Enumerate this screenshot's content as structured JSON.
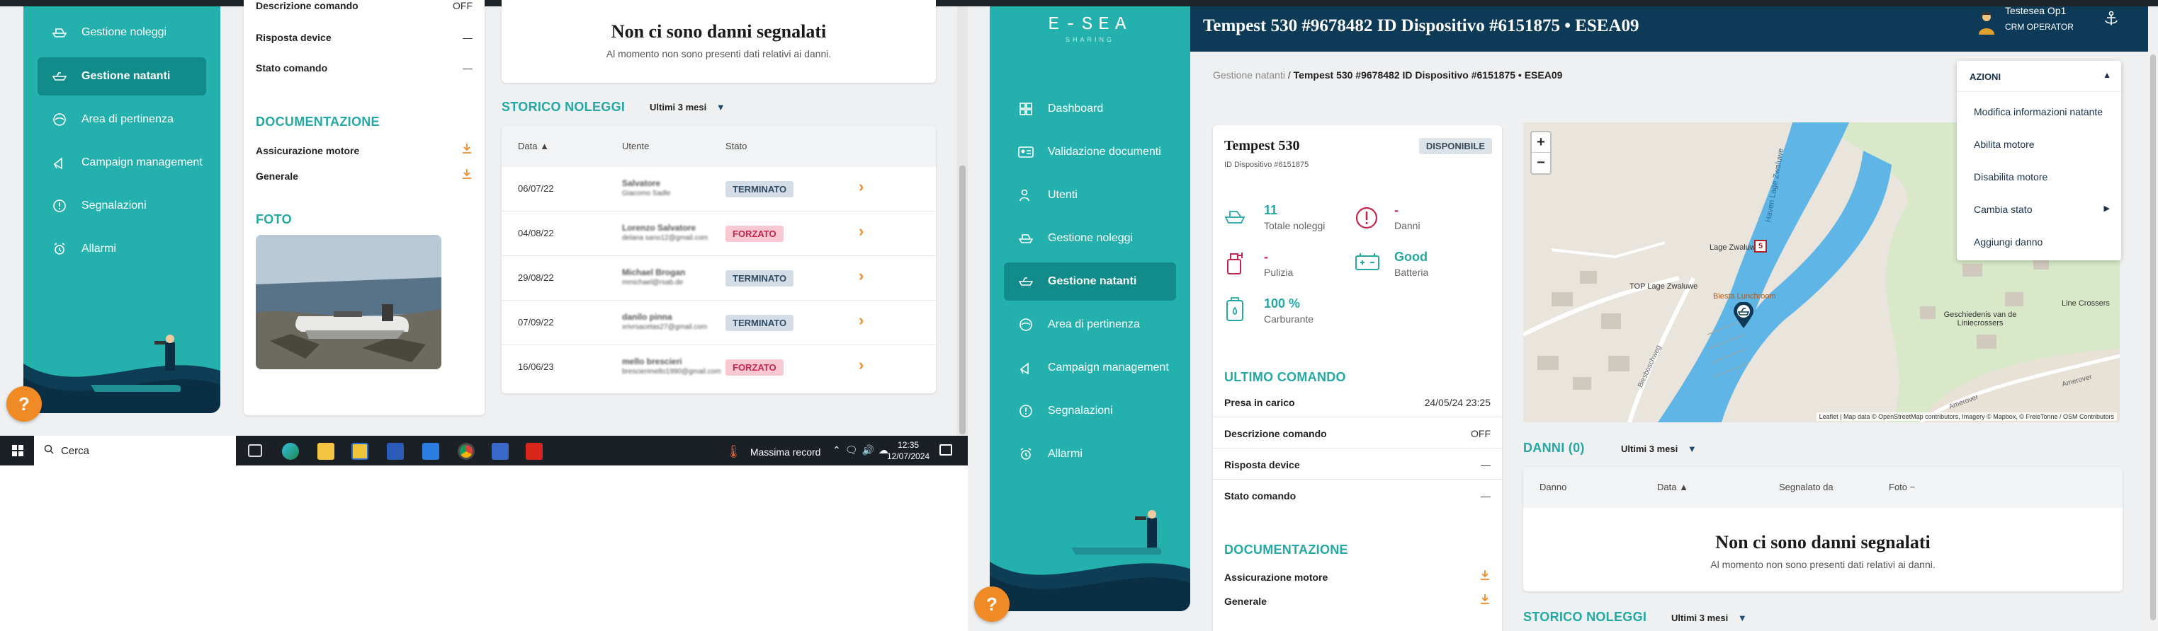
{
  "left": {
    "sidebar": {
      "items": [
        {
          "label": "Gestione noleggi",
          "icon": "boat-rental-icon"
        },
        {
          "label": "Gestione natanti",
          "icon": "boat-icon"
        },
        {
          "label": "Area di pertinenza",
          "icon": "area-icon"
        },
        {
          "label": "Campaign management",
          "icon": "megaphone-icon"
        },
        {
          "label": "Segnalazioni",
          "icon": "alert-circle-icon"
        },
        {
          "label": "Allarmi",
          "icon": "alarm-icon"
        }
      ]
    },
    "command": {
      "descrizione_label": "Descrizione comando",
      "descrizione_value": "OFF",
      "risposta_label": "Risposta device",
      "risposta_value": "—",
      "stato_label": "Stato comando",
      "stato_value": "—"
    },
    "documentazione": {
      "title": "DOCUMENTAZIONE",
      "items": [
        "Assicurazione motore",
        "Generale"
      ]
    },
    "foto_title": "FOTO",
    "danni_empty": {
      "title": "Non ci sono danni segnalati",
      "subtitle": "Al momento non sono presenti dati relativi ai danni."
    },
    "storico": {
      "title": "STORICO NOLEGGI",
      "filter": "Ultimi 3 mesi",
      "headers": {
        "data": "Data ▲",
        "utente": "Utente",
        "stato": "Stato"
      },
      "rows": [
        {
          "date": "06/07/22",
          "user1": "Salvatore",
          "user2": "Giacomo Sadle",
          "status": "TERMINATO"
        },
        {
          "date": "04/08/22",
          "user1": "Lorenzo Salvatore",
          "user2": "delana sano12@gmail.com",
          "status": "FORZATO"
        },
        {
          "date": "29/08/22",
          "user1": "Michael Brogan",
          "user2": "mmichael@rsab.de",
          "status": "TERMINATO"
        },
        {
          "date": "07/09/22",
          "user1": "danilo pinna",
          "user2": "xrivrsacetas27@gmail.com",
          "status": "TERMINATO"
        },
        {
          "date": "16/06/23",
          "user1": "mello brescieri",
          "user2": "brescierimello1990@gmail.com",
          "status": "FORZATO"
        }
      ]
    },
    "taskbar": {
      "search": "Cerca",
      "weather": "Massima record",
      "time": "12:35",
      "date": "12/07/2024"
    }
  },
  "right": {
    "brand": "E-SEA",
    "brand_sub": "SHARING",
    "header_title": "Tempest 530 #9678482 ID Dispositivo #6151875 • ESEA09",
    "user_name": "Testesea Op1",
    "user_role": "CRM OPERATOR",
    "breadcrumb": {
      "parent": "Gestione natanti",
      "sep": " / ",
      "current": "Tempest 530 #9678482 ID Dispositivo #6151875 • ESEA09"
    },
    "sidebar": {
      "items": [
        {
          "label": "Dashboard",
          "icon": "dashboard-icon"
        },
        {
          "label": "Validazione documenti",
          "icon": "id-card-icon"
        },
        {
          "label": "Utenti",
          "icon": "users-icon"
        },
        {
          "label": "Gestione noleggi",
          "icon": "boat-rental-icon"
        },
        {
          "label": "Gestione natanti",
          "icon": "boat-icon"
        },
        {
          "label": "Area di pertinenza",
          "icon": "area-icon"
        },
        {
          "label": "Campaign management",
          "icon": "megaphone-icon"
        },
        {
          "label": "Segnalazioni",
          "icon": "alert-circle-icon"
        },
        {
          "label": "Allarmi",
          "icon": "alarm-icon"
        }
      ]
    },
    "boat": {
      "name": "Tempest 530",
      "device": "ID Dispositivo #6151875",
      "status": "DISPONIBILE",
      "stats": {
        "noleggi_value": "11",
        "noleggi_label": "Totale noleggi",
        "danni_value": "-",
        "danni_label": "Danni",
        "pulizia_value": "-",
        "pulizia_label": "Pulizia",
        "batteria_value": "Good",
        "batteria_label": "Batteria",
        "carburante_value": "100 %",
        "carburante_label": "Carburante"
      }
    },
    "ultimo_comando": {
      "title": "ULTIMO COMANDO",
      "presa_label": "Presa in carico",
      "presa_value": "24/05/24 23:25",
      "descrizione_label": "Descrizione comando",
      "descrizione_value": "OFF",
      "risposta_label": "Risposta device",
      "risposta_value": "—",
      "stato_label": "Stato comando",
      "stato_value": "—"
    },
    "documentazione": {
      "title": "DOCUMENTAZIONE",
      "items": [
        "Assicurazione motore",
        "Generale"
      ]
    },
    "map": {
      "zoom_in": "+",
      "zoom_out": "−",
      "labels": {
        "lage": "Lage Zwaluwe",
        "top": "TOP Lage Zwaluwe",
        "biesta": "Biesta Lunchroom",
        "haven": "Haven Lage Zwaluwe",
        "gesch": "Geschiedenis van de Liniecrossers",
        "line": "Line Crossers",
        "street1": "Biesboschweg",
        "street2": "Amerover",
        "street3": "Amerover"
      },
      "marker_number": "5",
      "attribution": "Leaflet | Map data © OpenStreetMap contributors, Imagery © Mapbox, © FreieTonne / OSM Contributors"
    },
    "azioni": {
      "title": "AZIONI",
      "items": [
        "Modifica informazioni natante",
        "Abilita motore",
        "Disabilita motore",
        "Cambia stato",
        "Aggiungi danno"
      ]
    },
    "danni": {
      "title": "DANNI (0)",
      "filter": "Ultimi 3 mesi",
      "headers": {
        "danno": "Danno",
        "data": "Data ▲",
        "segnalato": "Segnalato da",
        "foto": "Foto −"
      },
      "empty_title": "Non ci sono danni segnalati",
      "empty_subtitle": "Al momento non sono presenti dati relativi ai danni."
    },
    "storico": {
      "title": "STORICO NOLEGGI",
      "filter": "Ultimi 3 mesi"
    }
  }
}
